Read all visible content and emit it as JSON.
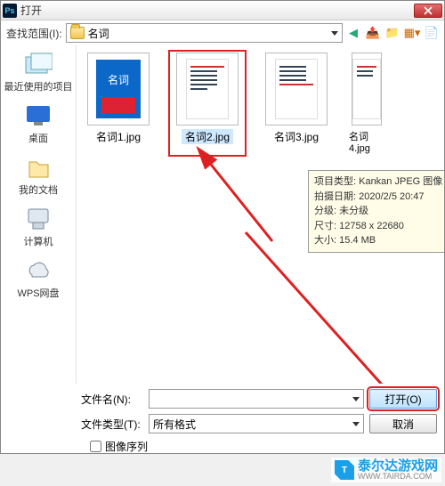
{
  "title": "打开",
  "close_icon": "x",
  "lookin": {
    "label": "查找范围(I):",
    "value": "名词"
  },
  "toolbar_icons": [
    "back",
    "up",
    "new-folder",
    "view",
    "extra"
  ],
  "places": [
    {
      "label": "最近使用的项目"
    },
    {
      "label": "桌面"
    },
    {
      "label": "我的文档"
    },
    {
      "label": "计算机"
    },
    {
      "label": "WPS网盘"
    }
  ],
  "files": [
    {
      "name": "名词1.jpg",
      "kind": "cover",
      "cover_text": "名词"
    },
    {
      "name": "名词2.jpg",
      "kind": "doc",
      "selected": true
    },
    {
      "name": "名词3.jpg",
      "kind": "doc"
    },
    {
      "name": "名词4.jpg",
      "kind": "doc"
    }
  ],
  "tooltip": {
    "l1": "项目类型: Kankan JPEG 图像",
    "l2": "拍摄日期: 2020/2/5 20:47",
    "l3": "分级: 未分级",
    "l4": "尺寸: 12758 x 22680",
    "l5": "大小: 15.4 MB"
  },
  "filename": {
    "label": "文件名(N):",
    "value": ""
  },
  "filetype": {
    "label": "文件类型(T):",
    "value": "所有格式"
  },
  "open_btn": "打开(O)",
  "cancel_btn": "取消",
  "image_seq": "图像序列",
  "watermark": {
    "name": "泰尔达游戏网",
    "url": "WWW.TAIRDA.COM"
  }
}
